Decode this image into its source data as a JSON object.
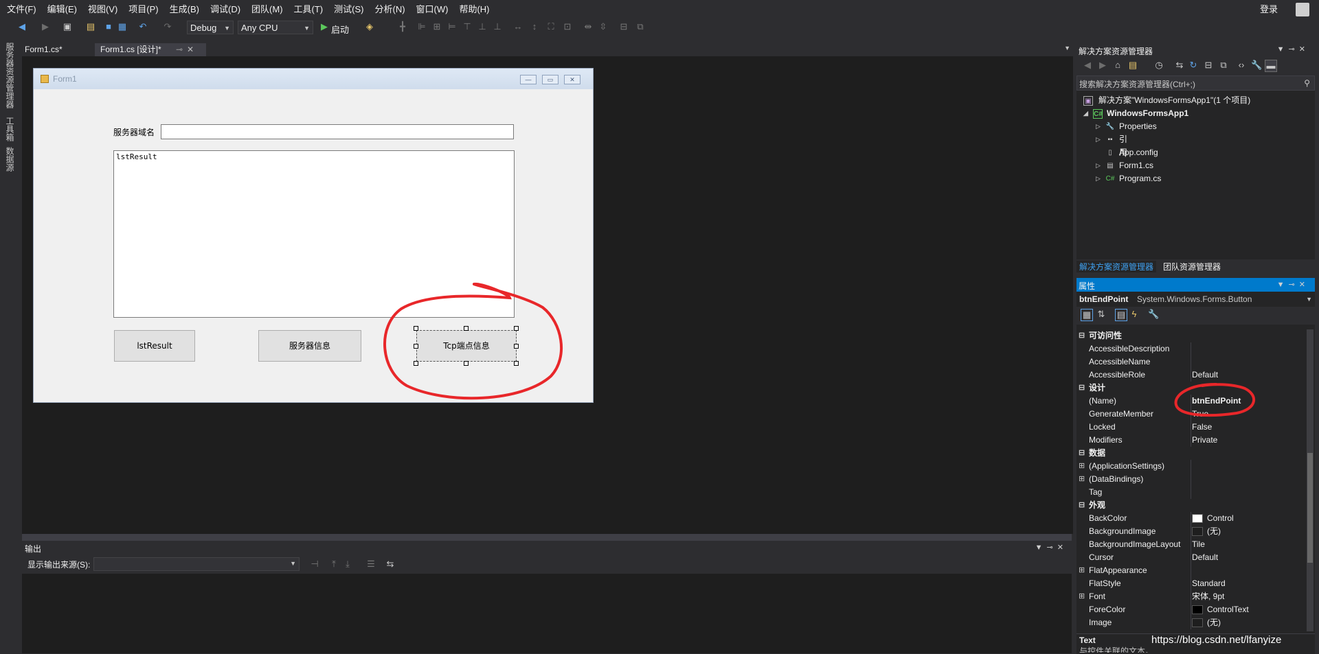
{
  "menu": [
    "文件(F)",
    "编辑(E)",
    "视图(V)",
    "项目(P)",
    "生成(B)",
    "调试(D)",
    "团队(M)",
    "工具(T)",
    "测试(S)",
    "分析(N)",
    "窗口(W)",
    "帮助(H)"
  ],
  "account": {
    "login_label": "登录"
  },
  "toolbar": {
    "config": "Debug",
    "platform": "Any CPU",
    "start_label": "启动"
  },
  "left_strip": [
    "服务器资源管理器",
    "工具箱",
    "数据源"
  ],
  "doc_tabs": [
    {
      "label": "Form1.cs*"
    },
    {
      "label": "Form1.cs [设计]*"
    }
  ],
  "form": {
    "title": "Form1",
    "host_label": "服务器域名",
    "host_value": "",
    "listbox_text": "lstResult",
    "buttons": {
      "lst": "lstResult",
      "server": "服务器信息",
      "tcp": "Tcp端点信息"
    }
  },
  "output": {
    "title": "输出",
    "source_label": "显示输出来源(S):",
    "source_value": ""
  },
  "solution": {
    "title": "解决方案资源管理器",
    "search_placeholder": "搜索解决方案资源管理器(Ctrl+;)",
    "tree": [
      {
        "label": "解决方案\"WindowsFormsApp1\"(1 个项目)",
        "icon": "solution-icon"
      },
      {
        "label": "WindowsFormsApp1",
        "icon": "csharp-project-icon"
      },
      {
        "label": "Properties",
        "icon": "wrench-icon"
      },
      {
        "label": "引用",
        "icon": "references-icon"
      },
      {
        "label": "App.config",
        "icon": "config-file-icon"
      },
      {
        "label": "Form1.cs",
        "icon": "form-file-icon"
      },
      {
        "label": "Program.cs",
        "icon": "csharp-file-icon"
      }
    ],
    "tabs": [
      "解决方案资源管理器",
      "团队资源管理器"
    ]
  },
  "properties": {
    "title": "属性",
    "object_name": "btnEndPoint",
    "object_type": "System.Windows.Forms.Button",
    "rows": [
      {
        "kind": "cat",
        "name": "可访问性",
        "exp": "⊟"
      },
      {
        "kind": "prop",
        "name": "AccessibleDescription",
        "value": ""
      },
      {
        "kind": "prop",
        "name": "AccessibleName",
        "value": ""
      },
      {
        "kind": "prop",
        "name": "AccessibleRole",
        "value": "Default"
      },
      {
        "kind": "cat",
        "name": "设计",
        "exp": "⊟"
      },
      {
        "kind": "prop",
        "name": "(Name)",
        "value": "btnEndPoint",
        "bold": true
      },
      {
        "kind": "prop",
        "name": "GenerateMember",
        "value": "True"
      },
      {
        "kind": "prop",
        "name": "Locked",
        "value": "False"
      },
      {
        "kind": "prop",
        "name": "Modifiers",
        "value": "Private"
      },
      {
        "kind": "cat",
        "name": "数据",
        "exp": "⊟"
      },
      {
        "kind": "prop",
        "name": "(ApplicationSettings)",
        "value": "",
        "exp": "⊞"
      },
      {
        "kind": "prop",
        "name": "(DataBindings)",
        "value": "",
        "exp": "⊞"
      },
      {
        "kind": "prop",
        "name": "Tag",
        "value": ""
      },
      {
        "kind": "cat",
        "name": "外观",
        "exp": "⊟"
      },
      {
        "kind": "prop",
        "name": "BackColor",
        "value": "Control",
        "swatch": "#ffffff"
      },
      {
        "kind": "prop",
        "name": "BackgroundImage",
        "value": "(无)",
        "swatch": "#1e1e1e"
      },
      {
        "kind": "prop",
        "name": "BackgroundImageLayout",
        "value": "Tile"
      },
      {
        "kind": "prop",
        "name": "Cursor",
        "value": "Default"
      },
      {
        "kind": "prop",
        "name": "FlatAppearance",
        "value": "",
        "exp": "⊞"
      },
      {
        "kind": "prop",
        "name": "FlatStyle",
        "value": "Standard"
      },
      {
        "kind": "prop",
        "name": "Font",
        "value": "宋体, 9pt",
        "exp": "⊞"
      },
      {
        "kind": "prop",
        "name": "ForeColor",
        "value": "ControlText",
        "swatch": "#000000"
      },
      {
        "kind": "prop",
        "name": "Image",
        "value": "(无)",
        "swatch": "#1e1e1e"
      }
    ],
    "desc_title": "Text",
    "desc_text": "与控件关联的文本。"
  },
  "watermark": "https://blog.csdn.net/lfanyize",
  "colors": {
    "accent": "#007acc",
    "annotation": "#e8272a"
  }
}
